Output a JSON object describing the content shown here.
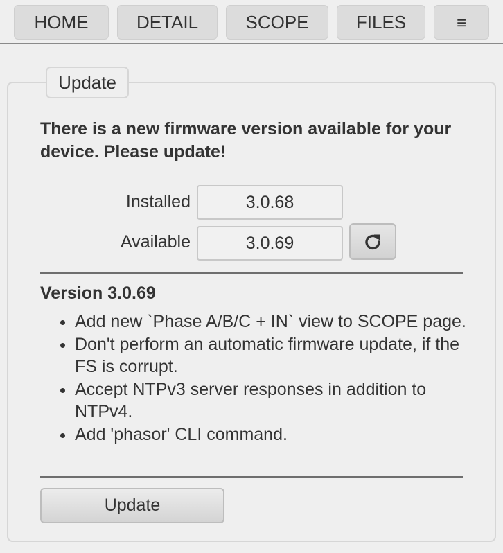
{
  "nav": {
    "tabs": [
      {
        "label": "HOME"
      },
      {
        "label": "DETAIL"
      },
      {
        "label": "SCOPE"
      },
      {
        "label": "FILES"
      },
      {
        "label": "≡",
        "icon": "hamburger-menu-icon"
      }
    ]
  },
  "update_panel": {
    "legend": "Update",
    "notice": "There is a new firmware version available for your device. Please update!",
    "installed_label": "Installed",
    "installed_value": "3.0.68",
    "available_label": "Available",
    "available_value": "3.0.69",
    "refresh_icon": "refresh-icon",
    "version_title": "Version 3.0.69",
    "release_notes": [
      "Add new `Phase A/B/C + IN` view to SCOPE page.",
      "Don't perform an automatic firmware update, if the FS is corrupt.",
      "Accept NTPv3 server responses in addition to NTPv4.",
      "Add 'phasor' CLI command."
    ],
    "update_button": "Update"
  }
}
